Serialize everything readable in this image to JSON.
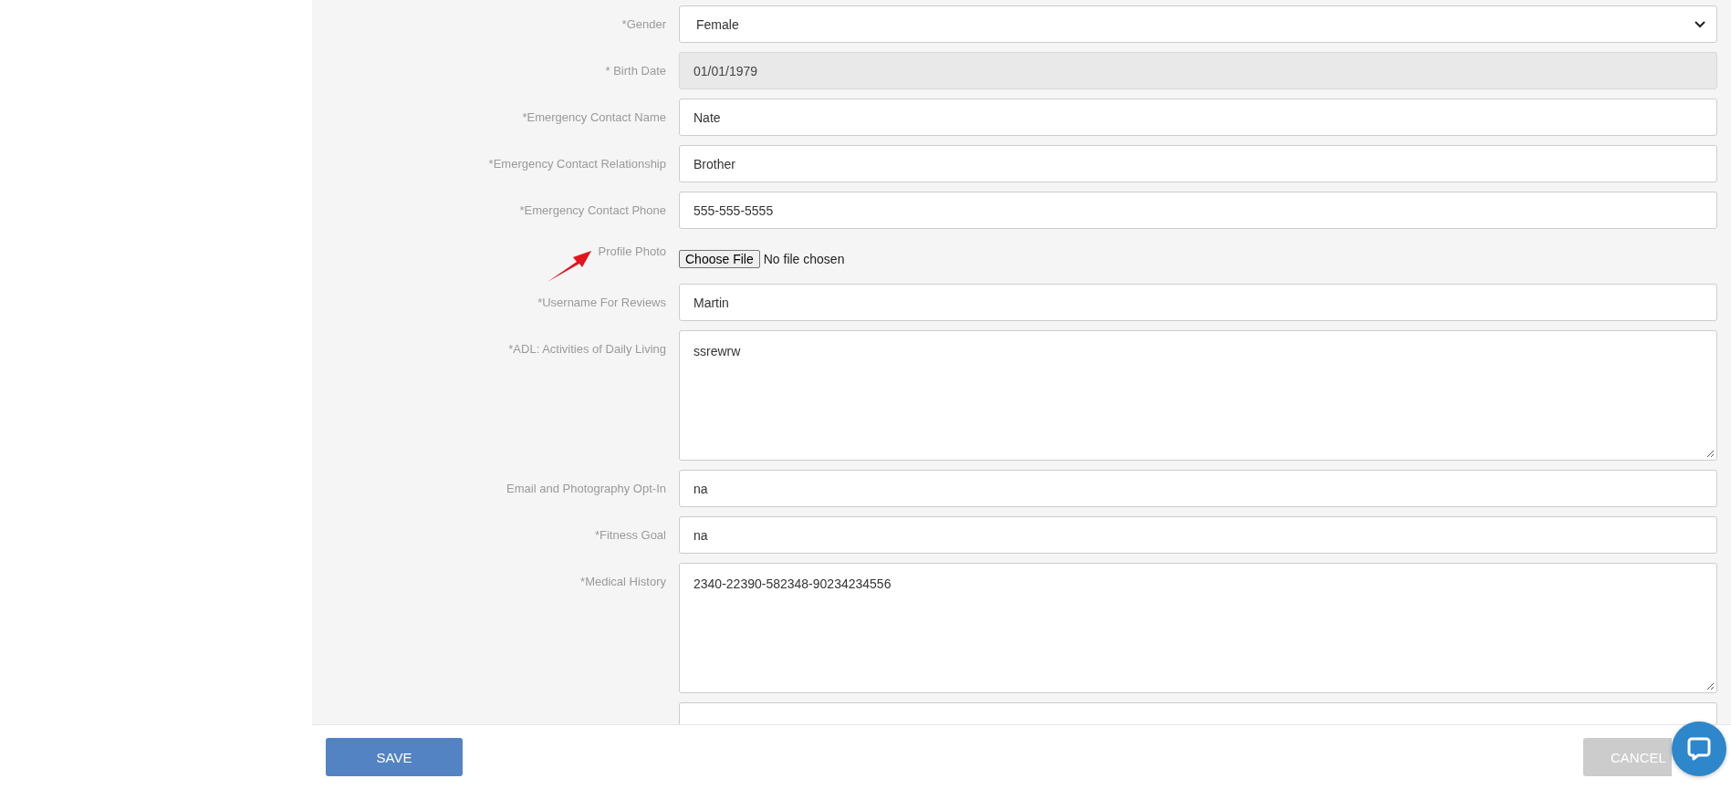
{
  "form": {
    "fields": [
      {
        "kind": "select",
        "label": "*Gender",
        "value": "Female",
        "disabled": false
      },
      {
        "kind": "text",
        "label": "* Birth Date",
        "value": "01/01/1979",
        "disabled": true
      },
      {
        "kind": "text",
        "label": "*Emergency Contact Name",
        "value": "Nate",
        "disabled": false
      },
      {
        "kind": "text",
        "label": "*Emergency Contact Relationship",
        "value": "Brother",
        "disabled": false
      },
      {
        "kind": "text",
        "label": "*Emergency Contact Phone",
        "value": "555-555-5555",
        "disabled": false
      },
      {
        "kind": "file",
        "label": "Profile Photo",
        "button": "Choose File",
        "status": "No file chosen",
        "annotated": true
      },
      {
        "kind": "text",
        "label": "*Username For Reviews",
        "value": "Martin",
        "disabled": false
      },
      {
        "kind": "textarea",
        "label": "*ADL: Activities of Daily Living",
        "value": "ssrewrw",
        "disabled": false
      },
      {
        "kind": "text",
        "label": "Email and Photography Opt-In",
        "value": "na",
        "disabled": false
      },
      {
        "kind": "text",
        "label": "*Fitness Goal",
        "value": "na",
        "disabled": false
      },
      {
        "kind": "textarea",
        "label": "*Medical History",
        "value": "2340-22390-582348-90234234556",
        "disabled": false
      },
      {
        "kind": "text",
        "disabled": false
      }
    ]
  },
  "footer": {
    "save": "SAVE",
    "cancel": "CANCEL",
    "cancel_disabled": true
  }
}
